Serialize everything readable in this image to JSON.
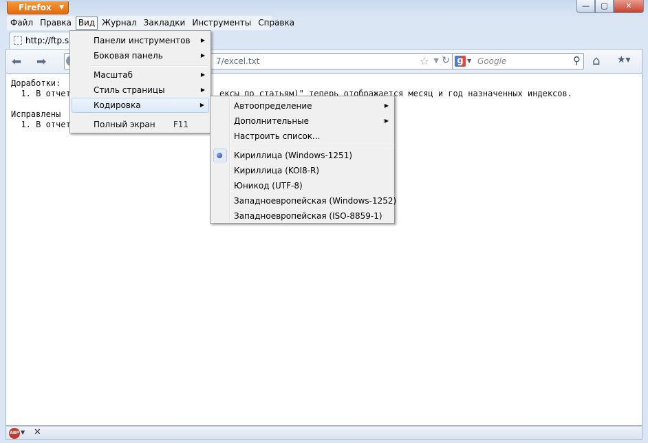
{
  "window": {
    "app_button": "Firefox",
    "minimize_icon": "—",
    "restore_icon": "▢",
    "close_icon": "✕"
  },
  "menubar": {
    "items": [
      "Файл",
      "Правка",
      "Вид",
      "Журнал",
      "Закладки",
      "Инструменты",
      "Справка"
    ],
    "active": "Вид"
  },
  "tab": {
    "label": "http://ftp.sm"
  },
  "navbar": {
    "url_visible": "7/excel.txt",
    "search_placeholder": "Google"
  },
  "content": {
    "lines": [
      "Доработки:",
      "  1. В отчет",
      "Исправлены",
      "  1. В отчет"
    ],
    "line1_tail": "ексы по статьям)\" теперь отображается месяц и год назначенных индексов."
  },
  "view_menu": {
    "items": [
      {
        "label": "Панели инструментов",
        "submenu": true
      },
      {
        "label": "Боковая панель",
        "submenu": true
      },
      {
        "label": "Масштаб",
        "submenu": true
      },
      {
        "label": "Стиль страницы",
        "submenu": true
      },
      {
        "label": "Кодировка",
        "submenu": true,
        "highlighted": true
      },
      {
        "label": "Полный экран",
        "shortcut": "F11"
      }
    ]
  },
  "encoding_menu": {
    "items": [
      {
        "label": "Автоопределение",
        "submenu": true
      },
      {
        "label": "Дополнительные",
        "submenu": true
      },
      {
        "label": "Настроить список..."
      },
      {
        "label": "Кириллица (Windows-1251)",
        "checked": true
      },
      {
        "label": "Кириллица (KOI8-R)"
      },
      {
        "label": "Юникод (UTF-8)"
      },
      {
        "label": "Западноевропейская (Windows-1252)"
      },
      {
        "label": "Западноевропейская (ISO-8859-1)"
      }
    ]
  },
  "statusbar": {
    "addon": "ABP"
  }
}
